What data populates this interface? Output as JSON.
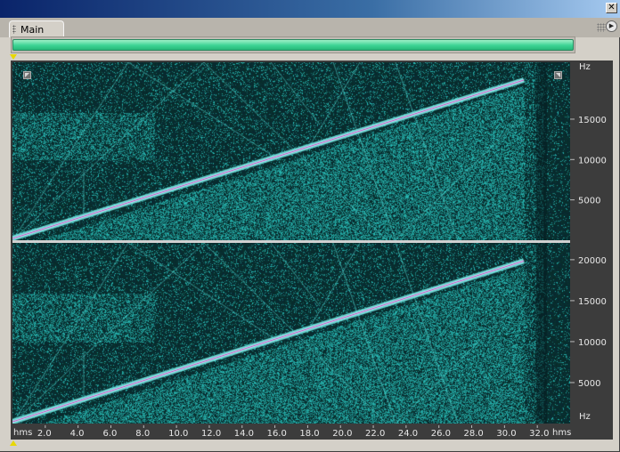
{
  "window": {
    "close_glyph": "✕"
  },
  "tabs": [
    {
      "label": "Main"
    }
  ],
  "panel": {
    "menu_glyph": "▶"
  },
  "spectral": {
    "unit_label": "Hz",
    "channels": [
      {
        "name": "top",
        "ticks": [
          {
            "label": "15000",
            "value": 15000
          },
          {
            "label": "10000",
            "value": 10000
          },
          {
            "label": "5000",
            "value": 5000
          }
        ],
        "top_label": "Hz"
      },
      {
        "name": "bottom",
        "ticks": [
          {
            "label": "20000",
            "value": 20000
          },
          {
            "label": "15000",
            "value": 15000
          },
          {
            "label": "10000",
            "value": 10000
          },
          {
            "label": "5000",
            "value": 5000
          }
        ],
        "bottom_label": "Hz"
      }
    ],
    "max_freq": 22050,
    "colors": {
      "background": "#0a2a2c",
      "noise": "#39c9c2",
      "signal": "#e0f8f8",
      "sweep_core": "#c040c0"
    }
  },
  "timeline": {
    "unit_left": "hms",
    "unit_right": "hms",
    "ticks": [
      "2.0",
      "4.0",
      "6.0",
      "8.0",
      "10.0",
      "12.0",
      "14.0",
      "16.0",
      "18.0",
      "20.0",
      "22.0",
      "24.0",
      "26.0",
      "28.0",
      "30.0",
      "32.0"
    ],
    "tick_values": [
      2,
      4,
      6,
      8,
      10,
      12,
      14,
      16,
      18,
      20,
      22,
      24,
      26,
      28,
      30,
      32
    ],
    "duration_shown": 34
  },
  "icons": {
    "close": "close-icon",
    "panel_menu": "panel-menu-icon",
    "tab_grip": "grip-icon",
    "start_marker": "start-marker-icon",
    "end_marker": "end-marker-icon"
  }
}
